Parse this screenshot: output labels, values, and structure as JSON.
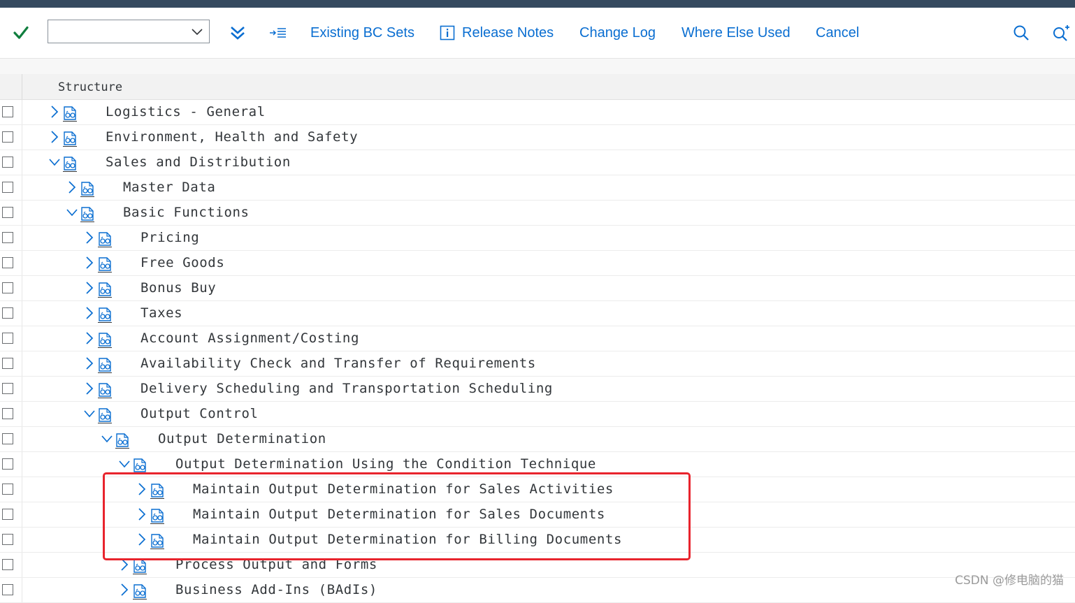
{
  "toolbar": {
    "command_value": "",
    "existing_bc_sets": "Existing BC Sets",
    "release_notes": "Release Notes",
    "change_log": "Change Log",
    "where_else_used": "Where Else Used",
    "cancel": "Cancel"
  },
  "tree": {
    "header": "Structure",
    "rows": [
      {
        "label": "Logistics - General",
        "level": 0,
        "state": "collapsed"
      },
      {
        "label": "Environment, Health and Safety",
        "level": 0,
        "state": "collapsed"
      },
      {
        "label": "Sales and Distribution",
        "level": 0,
        "state": "expanded"
      },
      {
        "label": "Master Data",
        "level": 1,
        "state": "collapsed"
      },
      {
        "label": "Basic Functions",
        "level": 1,
        "state": "expanded"
      },
      {
        "label": "Pricing",
        "level": 2,
        "state": "collapsed"
      },
      {
        "label": "Free Goods",
        "level": 2,
        "state": "collapsed"
      },
      {
        "label": "Bonus Buy",
        "level": 2,
        "state": "collapsed"
      },
      {
        "label": "Taxes",
        "level": 2,
        "state": "collapsed"
      },
      {
        "label": "Account Assignment/Costing",
        "level": 2,
        "state": "collapsed"
      },
      {
        "label": "Availability Check and Transfer of Requirements",
        "level": 2,
        "state": "collapsed"
      },
      {
        "label": "Delivery Scheduling and Transportation Scheduling",
        "level": 2,
        "state": "collapsed"
      },
      {
        "label": "Output Control",
        "level": 2,
        "state": "expanded"
      },
      {
        "label": "Output Determination",
        "level": 3,
        "state": "expanded"
      },
      {
        "label": "Output Determination Using the Condition Technique",
        "level": 4,
        "state": "expanded"
      },
      {
        "label": "Maintain Output Determination for Sales Activities",
        "level": 5,
        "state": "collapsed"
      },
      {
        "label": "Maintain Output Determination for Sales Documents",
        "level": 5,
        "state": "collapsed"
      },
      {
        "label": "Maintain Output Determination for Billing Documents",
        "level": 5,
        "state": "collapsed"
      },
      {
        "label": "Process Output and Forms",
        "level": 4,
        "state": "collapsed"
      },
      {
        "label": "Business Add-Ins (BAdIs)",
        "level": 4,
        "state": "collapsed"
      }
    ]
  },
  "watermark": "CSDN @修电脑的猫",
  "colors": {
    "link": "#0a6ed1",
    "check": "#107e3e",
    "highlight": "#e8242d",
    "shell_bar": "#354a5f"
  }
}
